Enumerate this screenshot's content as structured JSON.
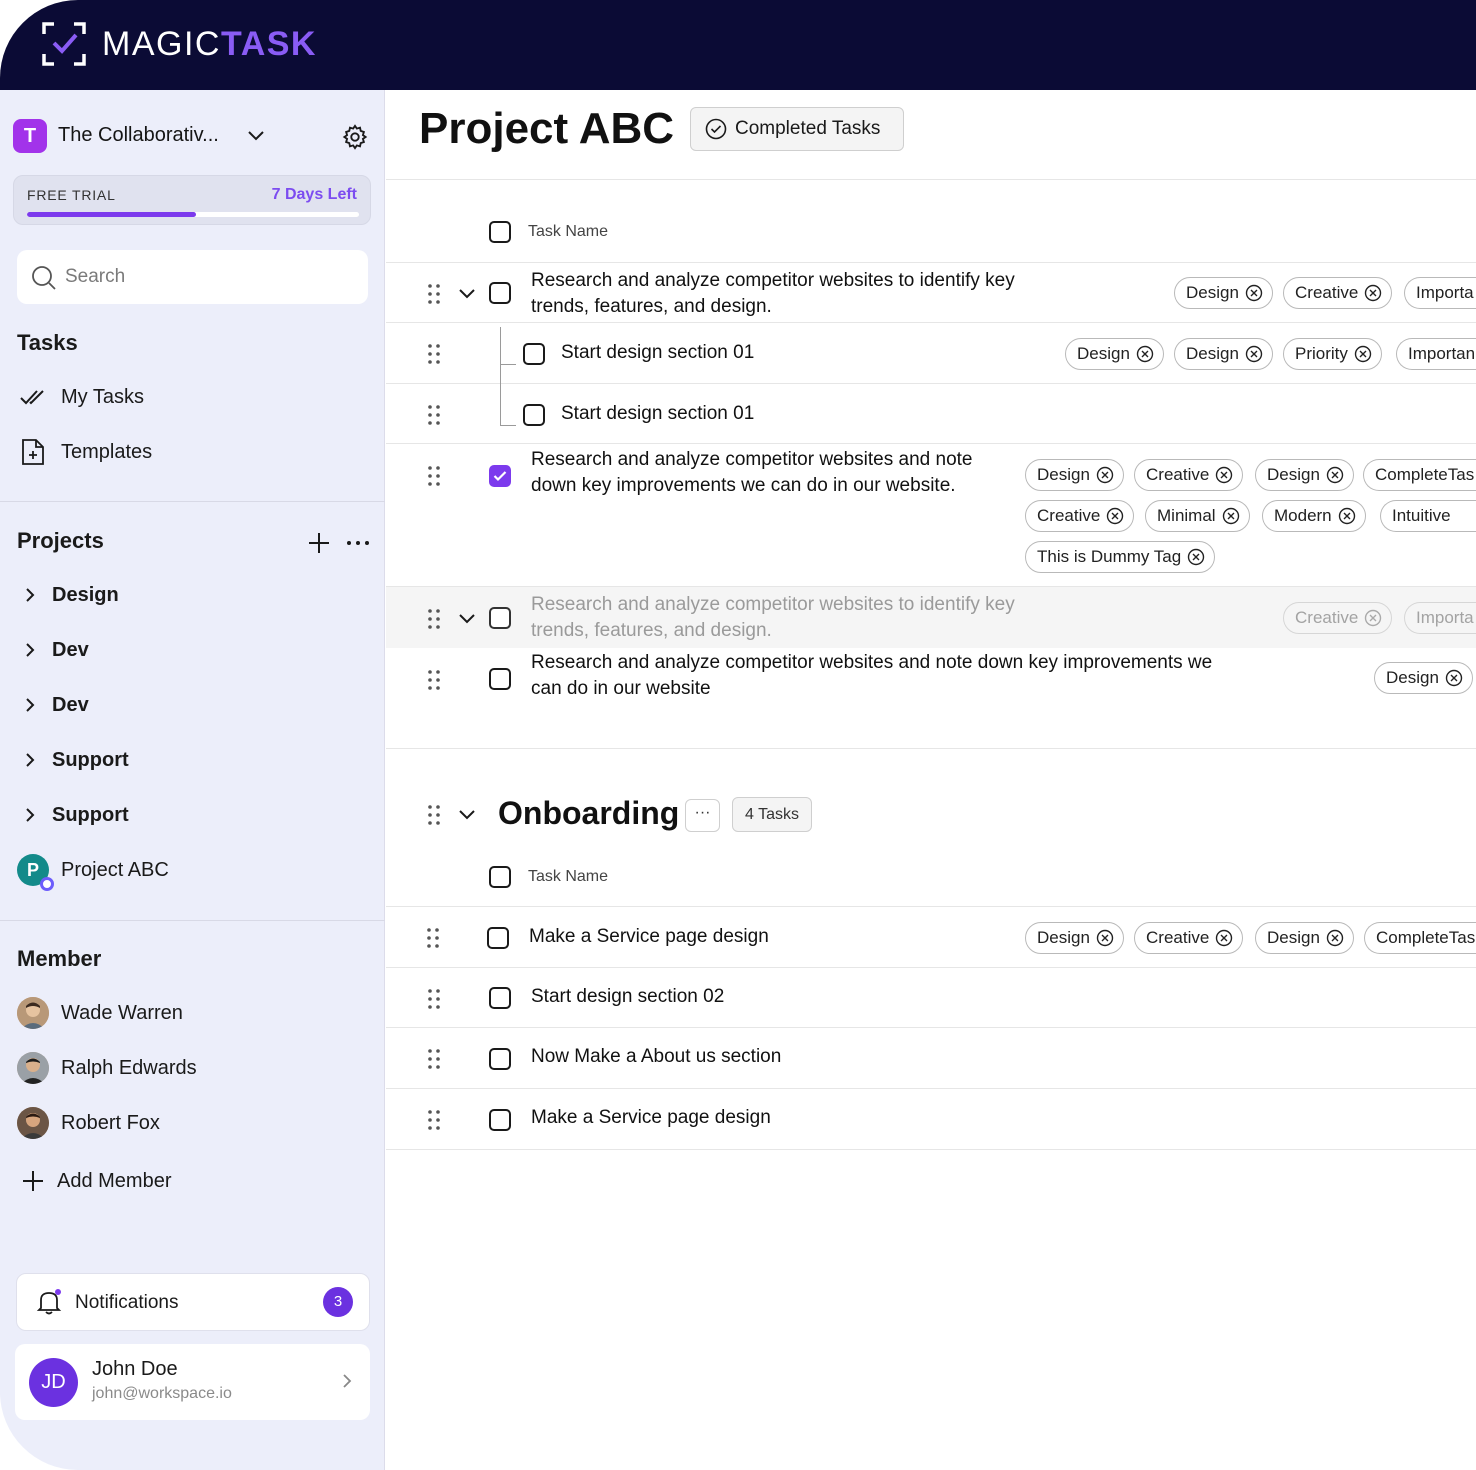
{
  "brand": {
    "name_part1": "MAGIC",
    "name_part2": "TASK"
  },
  "workspace": {
    "avatar_letter": "T",
    "name": "The Collaborativ..."
  },
  "trial": {
    "label": "FREE TRIAL",
    "days_left": "7 Days Left",
    "progress_fraction": 0.51
  },
  "search": {
    "placeholder": "Search"
  },
  "tasks_section": {
    "title": "Tasks",
    "items": [
      {
        "label": "My Tasks"
      },
      {
        "label": "Templates"
      }
    ]
  },
  "projects_section": {
    "title": "Projects",
    "items": [
      {
        "label": "Design"
      },
      {
        "label": "Dev"
      },
      {
        "label": "Dev"
      },
      {
        "label": "Support"
      },
      {
        "label": "Support"
      }
    ],
    "active_project": {
      "avatar_letter": "P",
      "label": "Project ABC"
    }
  },
  "members_section": {
    "title": "Member",
    "items": [
      {
        "name": "Wade Warren"
      },
      {
        "name": "Ralph Edwards"
      },
      {
        "name": "Robert Fox"
      }
    ],
    "add_label": "Add Member"
  },
  "notifications": {
    "label": "Notifications",
    "count": "3"
  },
  "user": {
    "initials": "JD",
    "name": "John Doe",
    "email": "john@workspace.io"
  },
  "main": {
    "title": "Project ABC",
    "completed_button": "Completed Tasks",
    "column_header": "Task Name",
    "tasks": [
      {
        "text_line1": "Research and analyze competitor websites to identify key",
        "text_line2": "trends, features, and design.",
        "tags": [
          "Design",
          "Creative",
          "Importa"
        ]
      },
      {
        "text": "Start design section 01",
        "tags": [
          "Design",
          "Design",
          "Priority",
          "Importan"
        ]
      },
      {
        "text": "Start design section 01",
        "tags": []
      },
      {
        "text_line1": "Research and analyze competitor websites and note",
        "text_line2": "down key improvements we can do in our website.",
        "checked": true,
        "tags": [
          "Design",
          "Creative",
          "Design",
          "CompleteTas",
          "Creative",
          "Minimal",
          "Modern",
          "Intuitive",
          "This is Dummy Tag"
        ]
      },
      {
        "text_line1": "Research and analyze competitor websites to identify key",
        "text_line2": "trends, features, and design.",
        "tags": [
          "Creative",
          "Importa"
        ]
      },
      {
        "text_line1": "Research and analyze competitor websites and note down key improvements we",
        "text_line2": "can do in our website",
        "tags": [
          "Design"
        ]
      }
    ]
  },
  "onboarding": {
    "title": "Onboarding",
    "more_label": "···",
    "count_label": "4 Tasks",
    "column_header": "Task Name",
    "tasks": [
      {
        "text": "Make a Service page design",
        "tags": [
          "Design",
          "Creative",
          "Design",
          "CompleteTas"
        ]
      },
      {
        "text": "Start design section 02"
      },
      {
        "text": "Now Make a About us section"
      },
      {
        "text": "Make a Service page design"
      }
    ]
  },
  "icons": {
    "logo": "logo-check-frame-icon",
    "settings": "gear-icon",
    "search": "search-icon",
    "my_tasks": "double-check-icon",
    "templates": "file-plus-icon",
    "add_project": "plus-icon",
    "drag": "drag-handle-icon",
    "tag_remove": "x-circle-icon",
    "notifications": "bell-icon"
  },
  "colors": {
    "accent": "#7c3aed",
    "topbar": "#0b0b35",
    "sidebar": "#eceefa",
    "workspace_avatar": "#a233ea",
    "project_avatar": "#138a8a"
  }
}
